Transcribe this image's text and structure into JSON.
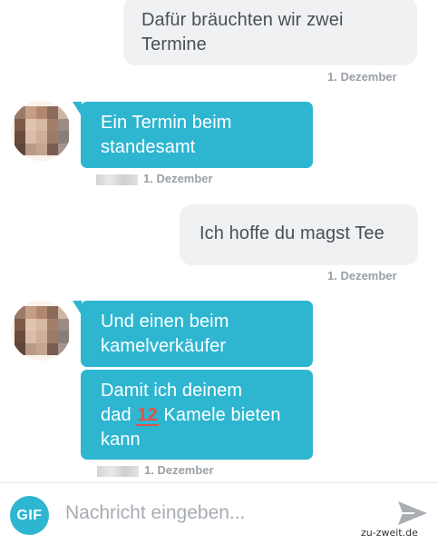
{
  "messages": [
    {
      "text": "Dafür bräuchten wir zwei Termine",
      "line1": "Dafür bräuchten wir zwei",
      "line2": "Termine",
      "direction": "outgoing"
    },
    {
      "text": "Ein Termin beim standesamt",
      "line1": "Ein Termin beim",
      "line2": "standesamt",
      "direction": "incoming"
    },
    {
      "text": "Ich hoffe du magst Tee",
      "direction": "outgoing"
    },
    {
      "text": "Und einen beim kamelverkäufer",
      "line1": "Und einen beim",
      "line2": "kamelverkäufer",
      "direction": "incoming"
    },
    {
      "text_before": "Damit ich deinem",
      "line2_before": "dad",
      "number": "12",
      "line2_after": "Kamele bieten",
      "line3": "kann",
      "direction": "incoming"
    }
  ],
  "timestamps": {
    "t1": "1. Dezember",
    "t2": "1. Dezember",
    "t3": "1. Dezember",
    "t4": "1. Dezember"
  },
  "composer": {
    "gif_label": "GIF",
    "placeholder": "Nachricht eingeben...",
    "send_icon": "send-icon"
  },
  "watermark": "zu-zweit.de",
  "colors": {
    "incoming_bubble": "#2eb6d1",
    "outgoing_bubble": "#f0f1f3",
    "accent": "#2eb6d1"
  }
}
